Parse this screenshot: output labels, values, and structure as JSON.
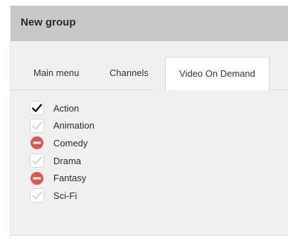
{
  "panel": {
    "title": "New group"
  },
  "tabs": [
    {
      "label": "Main menu",
      "active": false
    },
    {
      "label": "Channels",
      "active": false
    },
    {
      "label": "Video On Demand",
      "active": true
    }
  ],
  "genres": [
    {
      "label": "Action",
      "state": "checked"
    },
    {
      "label": "Animation",
      "state": "unchecked"
    },
    {
      "label": "Comedy",
      "state": "excluded"
    },
    {
      "label": "Drama",
      "state": "unchecked"
    },
    {
      "label": "Fantasy",
      "state": "excluded"
    },
    {
      "label": "Sci-Fi",
      "state": "unchecked"
    }
  ],
  "icons": {
    "checked": "checkmark-icon",
    "unchecked": "checkmark-faded-icon",
    "excluded": "no-entry-icon"
  },
  "colors": {
    "header_bg": "#c8c8c8",
    "panel_bg": "#f0f0f0",
    "check_dark": "#111111",
    "check_faded": "#cfcfcf",
    "excluded_red": "#e0564b"
  }
}
